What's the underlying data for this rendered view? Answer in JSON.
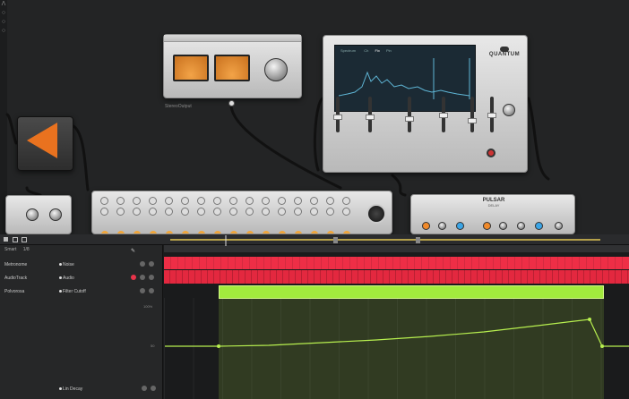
{
  "top_left_glyphs": [
    "Λ",
    "○",
    "○",
    "○"
  ],
  "devices": {
    "stereo_output": {
      "caption": "StereoOutput"
    },
    "quantum": {
      "brand": "QUANTUM",
      "screen_tabs": [
        "Spectrum",
        "Ch",
        "Fix",
        "Pin"
      ],
      "caption": ""
    },
    "left_device": {
      "caption": ""
    },
    "pulsar": {
      "brand": "PULSAR",
      "sub": "DELAY"
    },
    "mixer": {
      "caption": ""
    }
  },
  "arrangement": {
    "toolbar": {
      "snap_label": "Smart",
      "division": "1/8"
    },
    "tracks": [
      {
        "name": "Metronome",
        "device": "Noise",
        "color": "#e8344a"
      },
      {
        "name": "AudioTrack",
        "device": "Audio",
        "color": "#e8344a"
      },
      {
        "name": "Polvorosa",
        "device": "Filter Cutoff",
        "color": "#9be63a"
      }
    ],
    "automation_lane": {
      "device": "Lin Decay",
      "scale_top": "100%",
      "scale_mid": "50"
    }
  },
  "colors": {
    "accent_red": "#e8344a",
    "accent_green": "#9be63a",
    "vu_orange": "#f0a347"
  }
}
